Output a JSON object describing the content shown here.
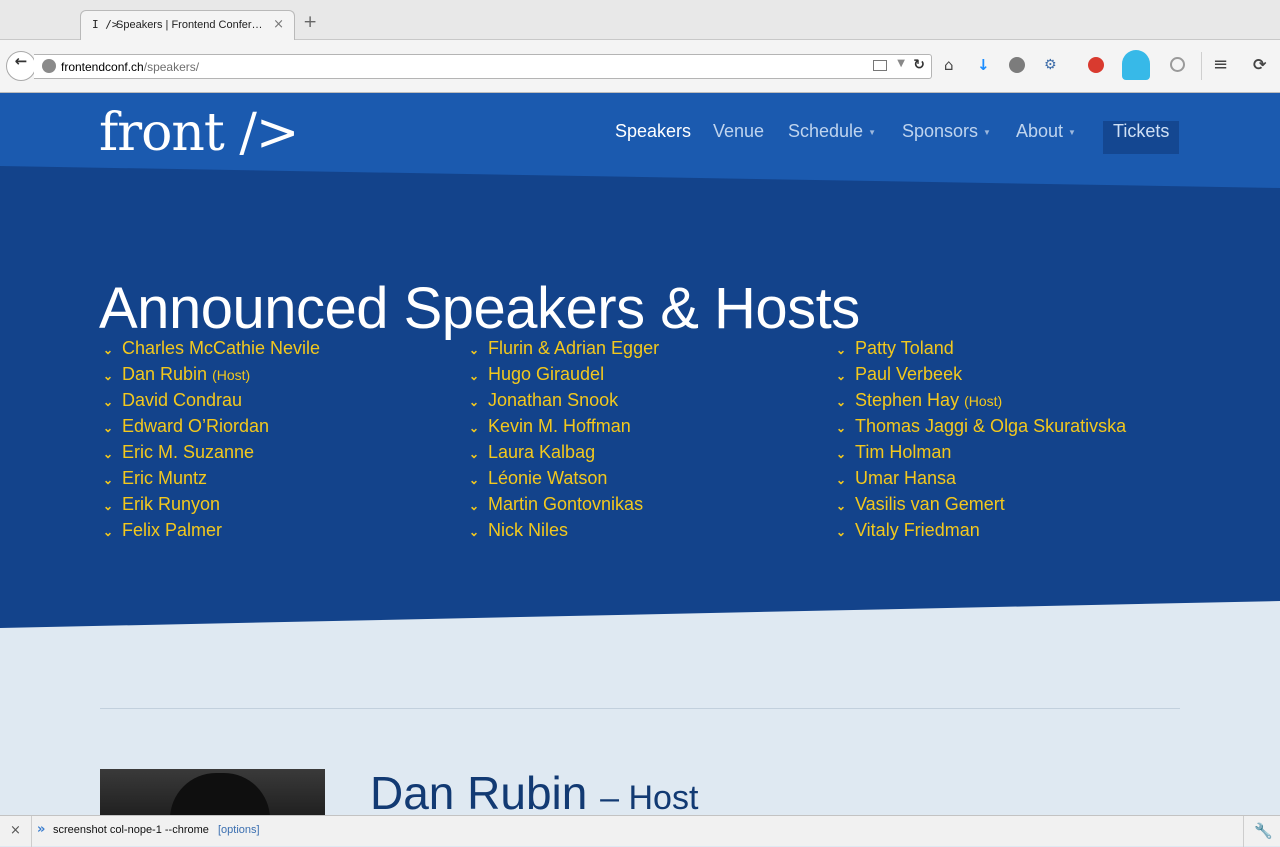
{
  "browser": {
    "tab": {
      "favicon": "I />",
      "title": "Speakers | Frontend Confer…",
      "close": "×"
    },
    "new_tab": "+",
    "url": {
      "domain": "frontendconf.ch",
      "path": "/speakers/"
    },
    "icons": [
      "back-arrow-icon",
      "globe-icon",
      "reader-view-icon",
      "dropdown-icon",
      "reload-icon",
      "home-icon",
      "download-icon",
      "ublock-icon",
      "network-icon",
      "extension-icon",
      "ghostery-icon",
      "extension-hex-icon",
      "menu-icon",
      "sync-icon"
    ]
  },
  "site": {
    "logo": "front />",
    "nav": [
      {
        "label": "Speakers",
        "active": true,
        "dropdown": false
      },
      {
        "label": "Venue",
        "active": false,
        "dropdown": false
      },
      {
        "label": "Schedule",
        "active": false,
        "dropdown": true
      },
      {
        "label": "Sponsors",
        "active": false,
        "dropdown": true
      },
      {
        "label": "About",
        "active": false,
        "dropdown": true
      },
      {
        "label": "Tickets",
        "active": false,
        "dropdown": false
      }
    ],
    "caret": "▼",
    "hero_title": "Announced Speakers & Hosts",
    "columns": [
      [
        {
          "name": "Charles McCathie Nevile",
          "note": ""
        },
        {
          "name": "Dan Rubin",
          "note": "(Host)"
        },
        {
          "name": "David Condrau",
          "note": ""
        },
        {
          "name": "Edward O’Riordan",
          "note": ""
        },
        {
          "name": "Eric M. Suzanne",
          "note": ""
        },
        {
          "name": "Eric Muntz",
          "note": ""
        },
        {
          "name": "Erik Runyon",
          "note": ""
        },
        {
          "name": "Felix Palmer",
          "note": ""
        }
      ],
      [
        {
          "name": "Flurin & Adrian Egger",
          "note": ""
        },
        {
          "name": "Hugo Giraudel",
          "note": ""
        },
        {
          "name": "Jonathan Snook",
          "note": ""
        },
        {
          "name": "Kevin M. Hoffman",
          "note": ""
        },
        {
          "name": "Laura Kalbag",
          "note": ""
        },
        {
          "name": "Léonie Watson",
          "note": ""
        },
        {
          "name": "Martin Gontovnikas",
          "note": ""
        },
        {
          "name": "Nick Niles",
          "note": ""
        }
      ],
      [
        {
          "name": "Patty Toland",
          "note": ""
        },
        {
          "name": "Paul Verbeek",
          "note": ""
        },
        {
          "name": "Stephen Hay",
          "note": "(Host)"
        },
        {
          "name": "Thomas Jaggi & Olga Skurativska",
          "note": ""
        },
        {
          "name": "Tim Holman",
          "note": ""
        },
        {
          "name": "Umar Hansa",
          "note": ""
        },
        {
          "name": "Vasilis van Gemert",
          "note": ""
        },
        {
          "name": "Vitaly Friedman",
          "note": ""
        }
      ]
    ],
    "chevron": "⌄",
    "featured": {
      "name": "Dan Rubin",
      "role": "– Host"
    },
    "colors": {
      "header": "#1b5aaf",
      "hero": "#13438b",
      "link": "#f3c81d",
      "page": "#dfe9f2"
    }
  },
  "devbar": {
    "close": "×",
    "prompt": "»",
    "command": "screenshot col-nope-1 --chrome",
    "options": "[options]"
  }
}
